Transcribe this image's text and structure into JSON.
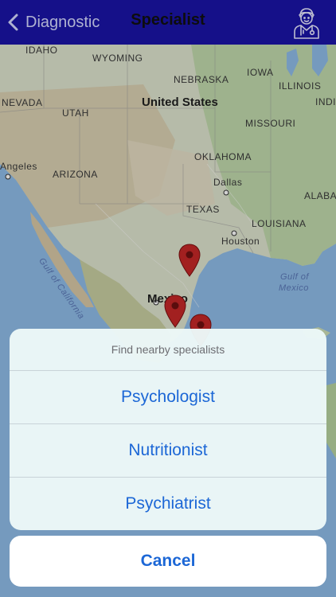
{
  "nav": {
    "back_label": "Diagnostic",
    "title": "Specialist",
    "profile_icon": "doctor-icon"
  },
  "map": {
    "labels": {
      "idaho": "IDAHO",
      "wyoming": "WYOMING",
      "iowa": "IOWA",
      "nebraska": "NEBRASKA",
      "illinois": "ILLINOIS",
      "indiana": "INDIA",
      "nevada": "NEVADA",
      "utah": "UTAH",
      "united_states": "United States",
      "missouri": "MISSOURI",
      "oklahoma": "OKLAHOMA",
      "los_angeles": "Angeles",
      "arizona": "ARIZONA",
      "dallas": "Dallas",
      "alabama": "ALABA",
      "texas": "TEXAS",
      "louisiana": "LOUISIANA",
      "houston": "Houston",
      "gulf_california": "Gulf of California",
      "gulf_mexico_1": "Gulf of",
      "gulf_mexico_2": "Mexico",
      "mexico": "Mexico"
    },
    "pin_color": "#c62828"
  },
  "action_sheet": {
    "title": "Find nearby specialists",
    "options": [
      {
        "label": "Psychologist"
      },
      {
        "label": "Nutritionist"
      },
      {
        "label": "Psychiatrist"
      }
    ],
    "cancel_label": "Cancel"
  },
  "colors": {
    "navbar": "#1a14a8",
    "accent": "#1c67d6"
  }
}
